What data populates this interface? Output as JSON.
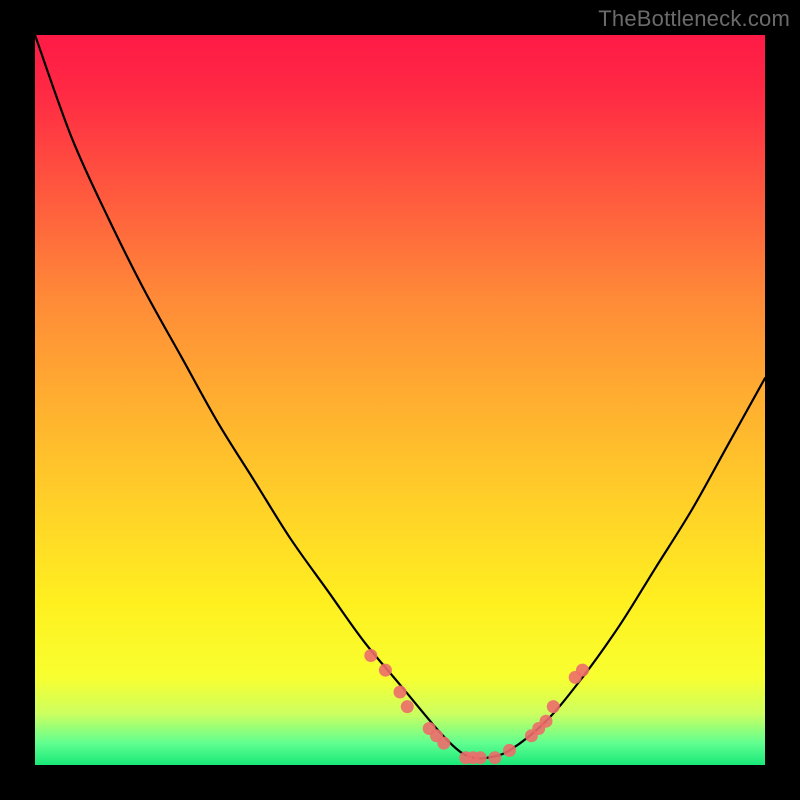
{
  "watermark": "TheBottleneck.com",
  "chart_data": {
    "type": "line",
    "title": "",
    "xlabel": "",
    "ylabel": "",
    "ylim": [
      0,
      100
    ],
    "xlim": [
      0,
      100
    ],
    "series": [
      {
        "name": "bottleneck-curve",
        "x": [
          0,
          5,
          10,
          15,
          20,
          25,
          30,
          35,
          40,
          45,
          50,
          55,
          58,
          60,
          62,
          65,
          70,
          75,
          80,
          85,
          90,
          95,
          100
        ],
        "y": [
          100,
          86,
          75,
          65,
          56,
          47,
          39,
          31,
          24,
          17,
          11,
          5,
          2,
          1,
          1,
          2,
          6,
          12,
          19,
          27,
          35,
          44,
          53
        ]
      }
    ],
    "markers": {
      "name": "highlighted-points",
      "color": "#ec6d6a",
      "x": [
        46,
        48,
        50,
        51,
        54,
        55,
        56,
        59,
        60,
        61,
        63,
        65,
        68,
        69,
        70,
        71,
        74,
        75
      ],
      "y": [
        15,
        13,
        10,
        8,
        5,
        4,
        3,
        1,
        1,
        1,
        1,
        2,
        4,
        5,
        6,
        8,
        12,
        13
      ]
    },
    "background_gradient": {
      "top_color": "#ff1a46",
      "bottom_color": "#18e878",
      "stops": [
        "#ff1a46",
        "#ff8a38",
        "#ffd028",
        "#f8ff30",
        "#18e878"
      ]
    }
  }
}
